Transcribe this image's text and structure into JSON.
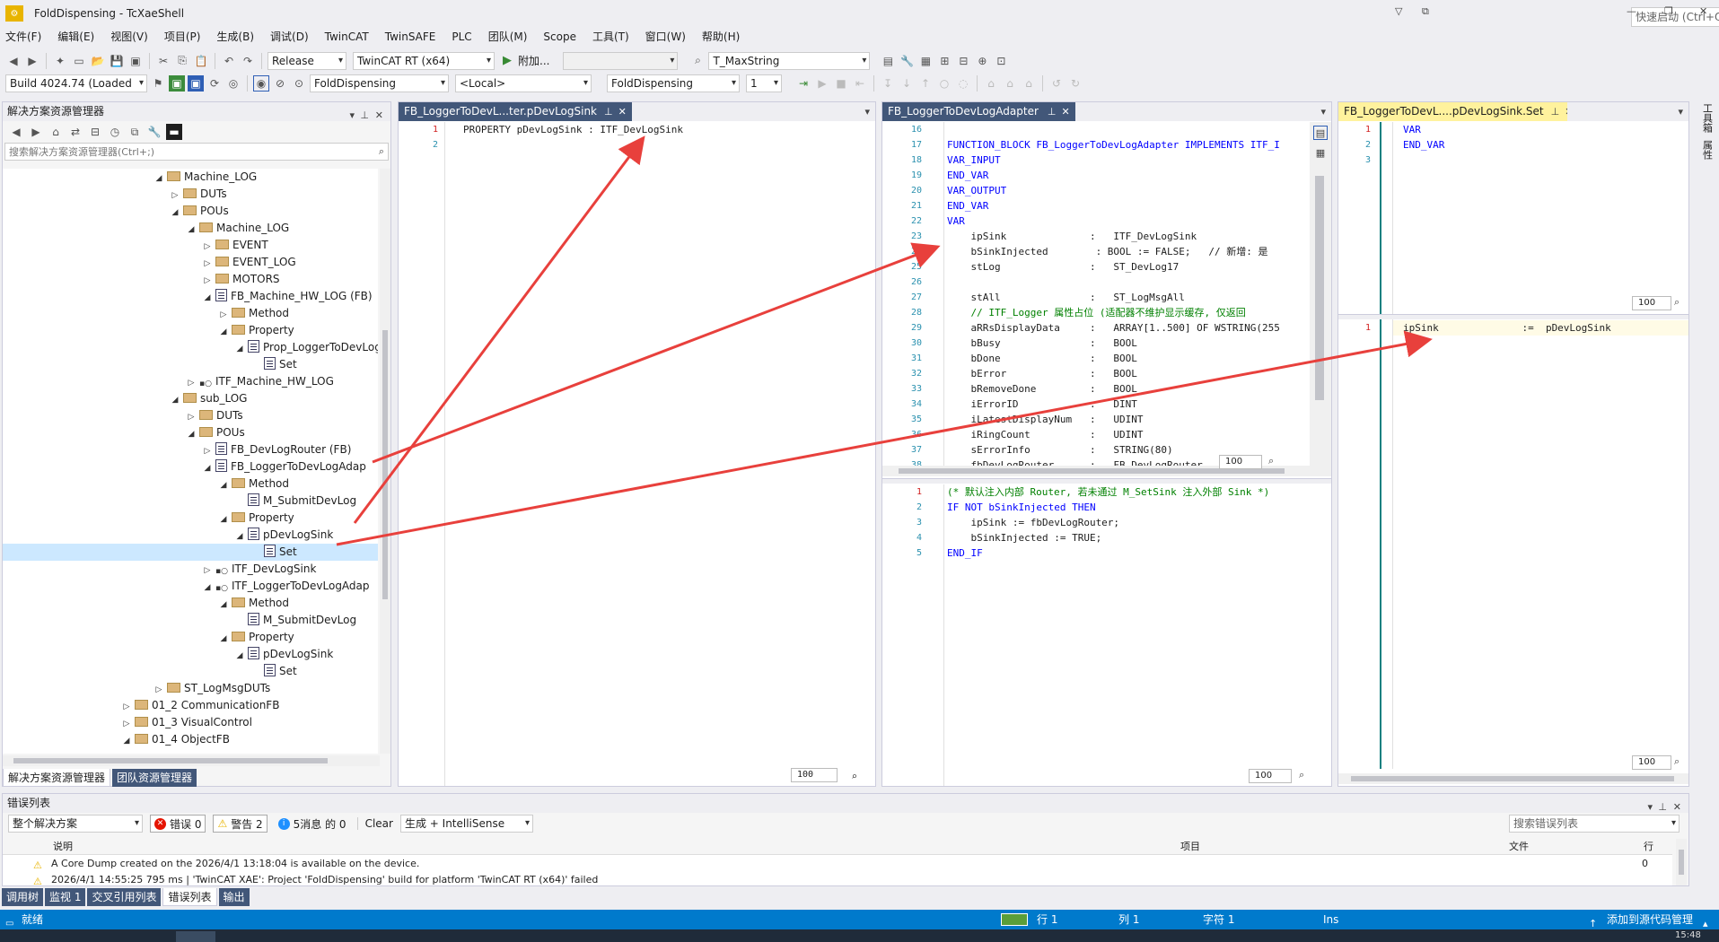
{
  "app": {
    "title": "FoldDispensing - TcXaeShell",
    "quick_launch": "快速启动 (Ctrl+Q)"
  },
  "menu": [
    "文件(F)",
    "编辑(E)",
    "视图(V)",
    "项目(P)",
    "生成(B)",
    "调试(D)",
    "TwinCAT",
    "TwinSAFE",
    "PLC",
    "团队(M)",
    "Scope",
    "工具(T)",
    "窗口(W)",
    "帮助(H)"
  ],
  "toolbar1": {
    "config": "Release",
    "platform": "TwinCAT RT (x64)",
    "attach": "附加...",
    "type_combo": "T_MaxString"
  },
  "toolbar2": {
    "build": "Build 4024.74 (Loaded",
    "project": "FoldDispensing",
    "target": "<Local>",
    "plc": "FoldDispensing",
    "task": "1"
  },
  "solution_explorer": {
    "title": "解决方案资源管理器",
    "search": "搜索解决方案资源管理器(Ctrl+;)",
    "items": [
      {
        "label": "Machine_LOG",
        "kind": "folder",
        "depth": 0,
        "exp": "open"
      },
      {
        "label": "DUTs",
        "kind": "folder",
        "depth": 1,
        "exp": "closed"
      },
      {
        "label": "POUs",
        "kind": "folder",
        "depth": 1,
        "exp": "open"
      },
      {
        "label": "Machine_LOG",
        "kind": "folder",
        "depth": 2,
        "exp": "open"
      },
      {
        "label": "EVENT",
        "kind": "folder",
        "depth": 3,
        "exp": "closed"
      },
      {
        "label": "EVENT_LOG",
        "kind": "folder",
        "depth": 3,
        "exp": "closed"
      },
      {
        "label": "MOTORS",
        "kind": "folder",
        "depth": 3,
        "exp": "closed"
      },
      {
        "label": "FB_Machine_HW_LOG (FB)",
        "kind": "file",
        "depth": 3,
        "exp": "open"
      },
      {
        "label": "Method",
        "kind": "folder",
        "depth": 4,
        "exp": "closed"
      },
      {
        "label": "Property",
        "kind": "folder",
        "depth": 4,
        "exp": "open"
      },
      {
        "label": "Prop_LoggerToDevLog",
        "kind": "file",
        "depth": 5,
        "exp": "open"
      },
      {
        "label": "Set",
        "kind": "file",
        "depth": 6,
        "exp": "none"
      },
      {
        "label": "ITF_Machine_HW_LOG",
        "kind": "itf",
        "depth": 2,
        "exp": "closed"
      },
      {
        "label": "sub_LOG",
        "kind": "folder",
        "depth": 1,
        "exp": "open"
      },
      {
        "label": "DUTs",
        "kind": "folder",
        "depth": 2,
        "exp": "closed"
      },
      {
        "label": "POUs",
        "kind": "folder",
        "depth": 2,
        "exp": "open"
      },
      {
        "label": "FB_DevLogRouter (FB)",
        "kind": "file",
        "depth": 3,
        "exp": "closed"
      },
      {
        "label": "FB_LoggerToDevLogAdap",
        "kind": "file",
        "depth": 3,
        "exp": "open"
      },
      {
        "label": "Method",
        "kind": "folder",
        "depth": 4,
        "exp": "open"
      },
      {
        "label": "M_SubmitDevLog",
        "kind": "file",
        "depth": 5,
        "exp": "none"
      },
      {
        "label": "Property",
        "kind": "folder",
        "depth": 4,
        "exp": "open"
      },
      {
        "label": "pDevLogSink",
        "kind": "file",
        "depth": 5,
        "exp": "open"
      },
      {
        "label": "Set",
        "kind": "file",
        "depth": 6,
        "exp": "none",
        "selected": true
      },
      {
        "label": "ITF_DevLogSink",
        "kind": "itf",
        "depth": 3,
        "exp": "closed"
      },
      {
        "label": "ITF_LoggerToDevLogAdap",
        "kind": "itf",
        "depth": 3,
        "exp": "open"
      },
      {
        "label": "Method",
        "kind": "folder",
        "depth": 4,
        "exp": "open"
      },
      {
        "label": "M_SubmitDevLog",
        "kind": "file",
        "depth": 5,
        "exp": "none"
      },
      {
        "label": "Property",
        "kind": "folder",
        "depth": 4,
        "exp": "open"
      },
      {
        "label": "pDevLogSink",
        "kind": "file",
        "depth": 5,
        "exp": "open"
      },
      {
        "label": "Set",
        "kind": "file",
        "depth": 6,
        "exp": "none"
      },
      {
        "label": "ST_LogMsgDUTs",
        "kind": "folder",
        "depth": 0,
        "exp": "closed"
      },
      {
        "label": "01_2 CommunicationFB",
        "kind": "folder",
        "depth": -2,
        "exp": "closed"
      },
      {
        "label": "01_3 VisualControl",
        "kind": "folder",
        "depth": -2,
        "exp": "closed"
      },
      {
        "label": "01_4 ObjectFB",
        "kind": "folder",
        "depth": -2,
        "exp": "open"
      }
    ],
    "bottom_tabs": [
      "解决方案资源管理器",
      "团队资源管理器"
    ]
  },
  "editor1": {
    "tab": "FB_LoggerToDevL...ter.pDevLogSink",
    "lines": [
      "1",
      "2"
    ],
    "code": "PROPERTY pDevLogSink : ITF_DevLogSink",
    "zoom": "100"
  },
  "editor2": {
    "tab": "FB_LoggerToDevLogAdapter",
    "decl_lines": [
      {
        "n": "16",
        "t": ""
      },
      {
        "n": "17",
        "t": "FUNCTION_BLOCK FB_LoggerToDevLogAdapter IMPLEMENTS ITF_I"
      },
      {
        "n": "18",
        "t": "VAR_INPUT"
      },
      {
        "n": "19",
        "t": "END_VAR"
      },
      {
        "n": "20",
        "t": "VAR_OUTPUT"
      },
      {
        "n": "21",
        "t": "END_VAR"
      },
      {
        "n": "22",
        "t": "VAR"
      },
      {
        "n": "23",
        "t": "    ipSink              :   ITF_DevLogSink"
      },
      {
        "n": "24",
        "t": "    bSinkInjected        : BOOL := FALSE;   // 新增: 是"
      },
      {
        "n": "25",
        "t": "    stLog               :   ST_DevLog17"
      },
      {
        "n": "26",
        "t": ""
      },
      {
        "n": "27",
        "t": "    stAll               :   ST_LogMsgAll"
      },
      {
        "n": "28",
        "t": "    // ITF_Logger 属性占位 (适配器不维护显示缓存, 仅返回"
      },
      {
        "n": "29",
        "t": "    aRRsDisplayData     :   ARRAY[1..500] OF WSTRING(255"
      },
      {
        "n": "30",
        "t": "    bBusy               :   BOOL"
      },
      {
        "n": "31",
        "t": "    bDone               :   BOOL"
      },
      {
        "n": "32",
        "t": "    bError              :   BOOL"
      },
      {
        "n": "33",
        "t": "    bRemoveDone         :   BOOL"
      },
      {
        "n": "34",
        "t": "    iErrorID            :   DINT"
      },
      {
        "n": "35",
        "t": "    iLatestDisplayNum   :   UDINT"
      },
      {
        "n": "36",
        "t": "    iRingCount          :   UDINT"
      },
      {
        "n": "37",
        "t": "    sErrorInfo          :   STRING(80)"
      },
      {
        "n": "38",
        "t": "    fbDevLogRouter      :   FB_DevLogRouter"
      }
    ],
    "impl_lines": [
      {
        "n": "1",
        "t": "(* 默认注入内部 Router, 若未通过 M_SetSink 注入外部 Sink *)"
      },
      {
        "n": "2",
        "t": "IF NOT bSinkInjected THEN"
      },
      {
        "n": "3",
        "t": "    ipSink := fbDevLogRouter;"
      },
      {
        "n": "4",
        "t": "    bSinkInjected := TRUE;"
      },
      {
        "n": "5",
        "t": "END_IF"
      }
    ],
    "zoom_top": "100",
    "zoom_bottom": "100"
  },
  "editor3": {
    "tab": "FB_LoggerToDevL....pDevLogSink.Set",
    "decl_lines": [
      {
        "n": "1",
        "t": "VAR"
      },
      {
        "n": "2",
        "t": "END_VAR"
      },
      {
        "n": "3",
        "t": ""
      }
    ],
    "impl_lines": [
      {
        "n": "1",
        "t": "ipSink              :=  pDevLogSink"
      }
    ],
    "zoom_top": "100",
    "zoom_bottom": "100"
  },
  "right_rail": [
    "工具箱",
    "属性"
  ],
  "error_list": {
    "title": "错误列表",
    "scope": "整个解决方案",
    "errors": "错误 0",
    "warnings": "警告 2",
    "messages": "5消息 的 0",
    "clear": "Clear",
    "source": "生成 + IntelliSense",
    "search": "搜索错误列表",
    "columns": {
      "desc": "说明",
      "project": "项目",
      "file": "文件",
      "line": "行"
    },
    "rows": [
      {
        "desc": "A Core Dump created on the 2026/4/1 13:18:04 is available on the device.",
        "line": "0"
      },
      {
        "desc": "2026/4/1 14:55:25 795 ms | 'TwinCAT XAE': Project 'FoldDispensing' build for platform 'TwinCAT RT (x64)' failed",
        "line": ""
      }
    ]
  },
  "bottom_tabs": [
    "调用树",
    "监视 1",
    "交叉引用列表",
    "错误列表",
    "输出"
  ],
  "status": {
    "ready": "就绪",
    "line": "行 1",
    "col": "列 1",
    "char": "字符 1",
    "ins": "Ins",
    "scm": "添加到源代码管理",
    "clock": "15:48"
  },
  "colors": {
    "accent": "#007acc",
    "arrow": "#e8403c",
    "tab_active": "#fff29d",
    "panel_head": "#425779"
  }
}
